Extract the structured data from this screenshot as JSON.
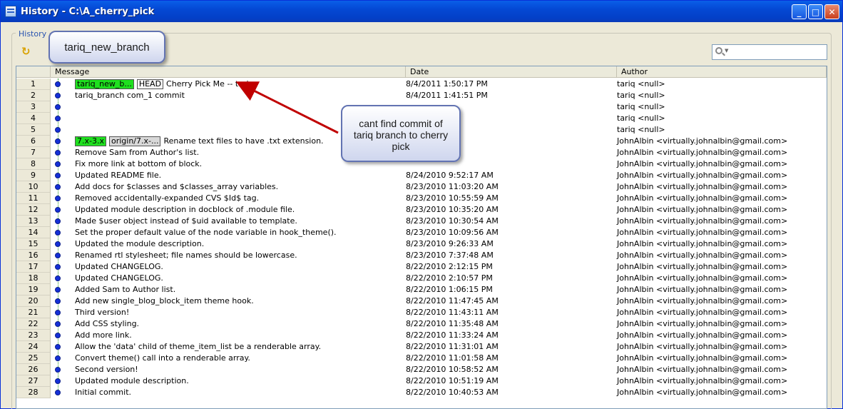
{
  "window": {
    "title": "History - C:\\A_cherry_pick",
    "minimize": "_",
    "maximize": "□",
    "close": "✕"
  },
  "panel": {
    "tab_label": "History",
    "refresh_icon": "↻",
    "search_placeholder": ""
  },
  "table": {
    "columns": [
      "",
      "Message",
      "Date",
      "Author"
    ],
    "rows": [
      {
        "num": "1",
        "tags": [
          {
            "text": "tariq_new_b...",
            "style": "green"
          },
          {
            "text": "HEAD",
            "style": "white"
          }
        ],
        "message": "Cherry Pick Me -- tariq",
        "date": "8/4/2011 1:50:17 PM",
        "author": "tariq <null>"
      },
      {
        "num": "2",
        "tags": [],
        "message": "tariq_branch com_1 commit",
        "date": "8/4/2011 1:41:51 PM",
        "author": "tariq <null>"
      },
      {
        "num": "3",
        "tags": [],
        "message": "",
        "date": "",
        "author": "tariq <null>"
      },
      {
        "num": "4",
        "tags": [],
        "message": "",
        "date": "",
        "author": "tariq <null>"
      },
      {
        "num": "5",
        "tags": [],
        "message": "",
        "date": "",
        "author": "tariq <null>"
      },
      {
        "num": "6",
        "tags": [
          {
            "text": "7.x-3.x",
            "style": "green"
          },
          {
            "text": "origin/7.x-...",
            "style": "gray"
          }
        ],
        "message": "Rename text files to have .txt extension.",
        "date": "",
        "author": "JohnAlbin <virtually.johnalbin@gmail.com>"
      },
      {
        "num": "7",
        "tags": [],
        "message": "Remove Sam from Author's list.",
        "date": "",
        "author": "JohnAlbin <virtually.johnalbin@gmail.com>"
      },
      {
        "num": "8",
        "tags": [],
        "message": "Fix more link at bottom of block.",
        "date": "",
        "author": "JohnAlbin <virtually.johnalbin@gmail.com>"
      },
      {
        "num": "9",
        "tags": [],
        "message": "Updated README file.",
        "date": "8/24/2010 9:52:17 AM",
        "author": "JohnAlbin <virtually.johnalbin@gmail.com>"
      },
      {
        "num": "10",
        "tags": [],
        "message": "Add docs for $classes and $classes_array variables.",
        "date": "8/23/2010 11:03:20 AM",
        "author": "JohnAlbin <virtually.johnalbin@gmail.com>"
      },
      {
        "num": "11",
        "tags": [],
        "message": "Removed accidentally-expanded CVS $Id$ tag.",
        "date": "8/23/2010 10:55:59 AM",
        "author": "JohnAlbin <virtually.johnalbin@gmail.com>"
      },
      {
        "num": "12",
        "tags": [],
        "message": "Updated module description in docblock of .module file.",
        "date": "8/23/2010 10:35:20 AM",
        "author": "JohnAlbin <virtually.johnalbin@gmail.com>"
      },
      {
        "num": "13",
        "tags": [],
        "message": "Made $user object instead of $uid available to template.",
        "date": "8/23/2010 10:30:54 AM",
        "author": "JohnAlbin <virtually.johnalbin@gmail.com>"
      },
      {
        "num": "14",
        "tags": [],
        "message": "Set the proper default value of the node variable in hook_theme().",
        "date": "8/23/2010 10:09:56 AM",
        "author": "JohnAlbin <virtually.johnalbin@gmail.com>"
      },
      {
        "num": "15",
        "tags": [],
        "message": "Updated the module description.",
        "date": "8/23/2010 9:26:33 AM",
        "author": "JohnAlbin <virtually.johnalbin@gmail.com>"
      },
      {
        "num": "16",
        "tags": [],
        "message": "Renamed rtl stylesheet; file names should be lowercase.",
        "date": "8/23/2010 7:37:48 AM",
        "author": "JohnAlbin <virtually.johnalbin@gmail.com>"
      },
      {
        "num": "17",
        "tags": [],
        "message": "Updated CHANGELOG.",
        "date": "8/22/2010 2:12:15 PM",
        "author": "JohnAlbin <virtually.johnalbin@gmail.com>"
      },
      {
        "num": "18",
        "tags": [],
        "message": "Updated CHANGELOG.",
        "date": "8/22/2010 2:10:57 PM",
        "author": "JohnAlbin <virtually.johnalbin@gmail.com>"
      },
      {
        "num": "19",
        "tags": [],
        "message": "Added Sam to Author list.",
        "date": "8/22/2010 1:06:15 PM",
        "author": "JohnAlbin <virtually.johnalbin@gmail.com>"
      },
      {
        "num": "20",
        "tags": [],
        "message": "Add new single_blog_block_item theme hook.",
        "date": "8/22/2010 11:47:45 AM",
        "author": "JohnAlbin <virtually.johnalbin@gmail.com>"
      },
      {
        "num": "21",
        "tags": [],
        "message": "Third version!",
        "date": "8/22/2010 11:43:11 AM",
        "author": "JohnAlbin <virtually.johnalbin@gmail.com>"
      },
      {
        "num": "22",
        "tags": [],
        "message": "Add CSS styling.",
        "date": "8/22/2010 11:35:48 AM",
        "author": "JohnAlbin <virtually.johnalbin@gmail.com>"
      },
      {
        "num": "23",
        "tags": [],
        "message": "Add more link.",
        "date": "8/22/2010 11:33:24 AM",
        "author": "JohnAlbin <virtually.johnalbin@gmail.com>"
      },
      {
        "num": "24",
        "tags": [],
        "message": "Allow the 'data' child of theme_item_list be a renderable array.",
        "date": "8/22/2010 11:31:01 AM",
        "author": "JohnAlbin <virtually.johnalbin@gmail.com>"
      },
      {
        "num": "25",
        "tags": [],
        "message": "Convert theme() call into a renderable array.",
        "date": "8/22/2010 11:01:58 AM",
        "author": "JohnAlbin <virtually.johnalbin@gmail.com>"
      },
      {
        "num": "26",
        "tags": [],
        "message": "Second version!",
        "date": "8/22/2010 10:58:52 AM",
        "author": "JohnAlbin <virtually.johnalbin@gmail.com>"
      },
      {
        "num": "27",
        "tags": [],
        "message": "Updated module description.",
        "date": "8/22/2010 10:51:19 AM",
        "author": "JohnAlbin <virtually.johnalbin@gmail.com>"
      },
      {
        "num": "28",
        "tags": [],
        "message": "Initial commit.",
        "date": "8/22/2010 10:40:53 AM",
        "author": "JohnAlbin <virtually.johnalbin@gmail.com>"
      }
    ]
  },
  "annotations": {
    "branch_callout": "tariq_new_branch",
    "note_callout": "cant find commit of tariq branch to cherry pick"
  },
  "colors": {
    "tag_green": "#1fdf1f",
    "commit_dot": "#1530d8",
    "arrow": "#c00000"
  }
}
